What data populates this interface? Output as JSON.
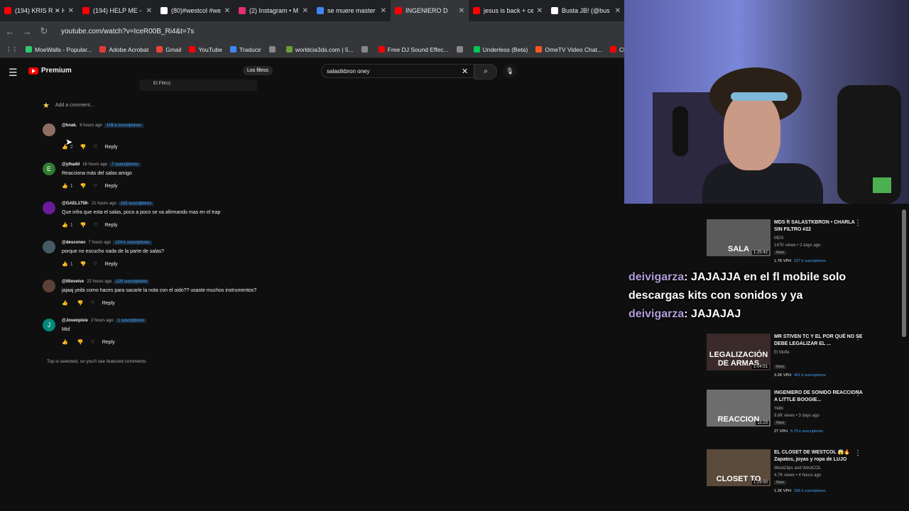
{
  "browser": {
    "tabs": [
      {
        "label": "(194) KRIS R ✕ H",
        "color": "#ff0000",
        "active": false
      },
      {
        "label": "(194) HELP ME - k",
        "color": "#ff0000",
        "active": false
      },
      {
        "label": "(80)#westcol #we",
        "color": "#ffffff",
        "active": false
      },
      {
        "label": "(2) Instagram • M",
        "color": "#e1306c",
        "active": false
      },
      {
        "label": "se muere master",
        "color": "#4285f4",
        "active": false
      },
      {
        "label": "INGENIERO D",
        "color": "#ff0000",
        "active": true
      },
      {
        "label": "jesus is back + ce",
        "color": "#ff0000",
        "active": false
      },
      {
        "label": "Busta JB! (@bus",
        "color": "#ffffff",
        "active": false
      }
    ],
    "url": "youtube.com/watch?v=IceR00B_Ri4&t=7s",
    "bookmarks": [
      {
        "label": "MoeWalls - Popular...",
        "color": "#2ecc71"
      },
      {
        "label": "Adobe Acrobat",
        "color": "#e53935"
      },
      {
        "label": "Gmail",
        "color": "#ea4335"
      },
      {
        "label": "YouTube",
        "color": "#ff0000"
      },
      {
        "label": "Traducir",
        "color": "#4285f4"
      },
      {
        "label": "",
        "color": "#888888"
      },
      {
        "label": "worldcia3ds.com | 5...",
        "color": "#6d9e3a"
      },
      {
        "label": "",
        "color": "#888888"
      },
      {
        "label": "Free DJ Sound Effec...",
        "color": "#ff0000"
      },
      {
        "label": "",
        "color": "#888888"
      },
      {
        "label": "Underless (Beta)",
        "color": "#00c853"
      },
      {
        "label": "OmeTV Video Chat...",
        "color": "#ff5722"
      },
      {
        "label": "Ch",
        "color": "#ff0000"
      }
    ]
  },
  "youtube": {
    "logo": "Premium",
    "filter_pill": "Los filtros",
    "search_value": "salastkbron oney",
    "filtro_label": "El Filtro)",
    "add_comment": "Add a comment...",
    "comments": [
      {
        "user": "@knak.",
        "time": "9 hours ago",
        "subs": "106 k suscriptores",
        "text": "",
        "likes": "2",
        "avatar_color": "#8d6e63",
        "avatar_letter": ""
      },
      {
        "user": "@yihadd",
        "time": "16 hours ago",
        "subs": "7 suscriptores",
        "text": "Reacciona más del salas amigo",
        "likes": "1",
        "avatar_color": "#2e7d32",
        "avatar_letter": "E"
      },
      {
        "user": "@GAEL1759-",
        "time": "21 hours ago",
        "subs": "115 suscriptores",
        "text": "Que infra que esta el salas, poco a poco se va afirmando mas en el trap",
        "likes": "1",
        "avatar_color": "#6a1b9a",
        "avatar_letter": ""
      },
      {
        "user": "@desconec",
        "time": "7 hours ago",
        "subs": "124 k suscriptores",
        "text": "porque no escucho nada de la parte de salas?",
        "likes": "1",
        "avatar_color": "#455a64",
        "avatar_letter": ""
      },
      {
        "user": "@lilloveive",
        "time": "22 hours ago",
        "subs": "220 suscriptores",
        "text": "jajaaj yeibi como haces para sacarle la nota con el oido?? usaste muchos instrumentos?",
        "likes": "",
        "avatar_color": "#5d4037",
        "avatar_letter": ""
      },
      {
        "user": "@Jovenpixie",
        "time": "2 hours ago",
        "subs": "1 suscriptores",
        "text": "Mid",
        "likes": "",
        "avatar_color": "#00897b",
        "avatar_letter": "J"
      }
    ],
    "reply_label": "Reply",
    "footer": "Top is selected, so you'll see featured comments"
  },
  "chat": [
    {
      "nick": "deivigarza",
      "msg": ": JAJAJJA en el fl mobile solo"
    },
    {
      "nick": "",
      "msg": "descargas kits con sonidos y ya"
    },
    {
      "nick": "deivigarza",
      "msg": ": JAJAJAJ"
    }
  ],
  "recommendations": [
    {
      "title": "MDS ft SALASTKBRON • CHARLA SIN FILTRO #22",
      "channel": "MDS",
      "views": "147K views • 2 days ago",
      "thumb_text": "SALA",
      "duration": "1:25:42",
      "stats": "1.7K VPH",
      "stats2": "227 k suscriptores",
      "thumb_color": "#5b5b5b"
    },
    {
      "title": "MR STIVEN TC Y EL POR QUÉ NO SE DEBE LEGALIZAR EL ...",
      "channel": "El Mufle",
      "views": "",
      "thumb_text": "LEGALIZACIÓN DE ARMAS",
      "duration": "1:04:51",
      "stats": "3.2K VPH",
      "stats2": "461 k suscriptores",
      "thumb_color": "#3a2a2a"
    },
    {
      "title": "INGENIERO DE SONIDO REACCIONA A LITTLE BOOGIE...",
      "channel": "Yeibi",
      "views": "8.8K views • 3 days ago",
      "thumb_text": "REACCION",
      "duration": "11:23",
      "stats": "27 VPH",
      "stats2": "5.75 k suscriptores",
      "thumb_color": "#6d6d6d"
    },
    {
      "title": "EL CLOSET DE WESTCOL 😱🔥 Zapatos, joyas y ropa de LUJO",
      "channel": "WestClips and WestCOL",
      "views": "4.7K views • 4 hours ago",
      "thumb_text": "CLOSET TO",
      "duration": "1:29:50",
      "stats": "1.2K VPH",
      "stats2": "266 k suscriptores",
      "thumb_color": "#5a4a3a"
    }
  ]
}
